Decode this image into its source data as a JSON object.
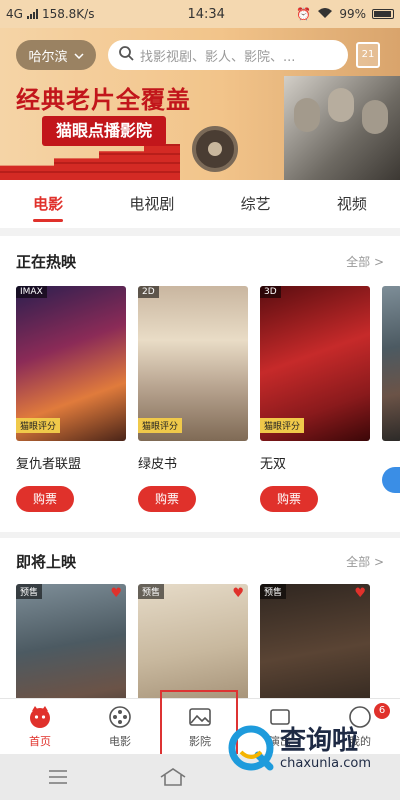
{
  "status_bar": {
    "network": "4G",
    "speed": "158.8K/s",
    "time": "14:34",
    "battery": "99%"
  },
  "header": {
    "city": "哈尔滨",
    "search_placeholder": "找影视剧、影人、影院、...",
    "calendar_day": "21"
  },
  "banner": {
    "headline": "经典老片全覆盖",
    "subline": "猫眼点播影院"
  },
  "tabs": [
    {
      "label": "电影"
    },
    {
      "label": "电视剧"
    },
    {
      "label": "综艺"
    },
    {
      "label": "视频"
    }
  ],
  "hot_section": {
    "title": "正在热映",
    "more": "全部 >",
    "cards": [
      {
        "name": "复仇者联盟",
        "button": "购票",
        "badge": "IMAX",
        "tag": "猫眼评分"
      },
      {
        "name": "绿皮书",
        "button": "购票",
        "badge": "2D",
        "tag": "猫眼评分"
      },
      {
        "name": "无双",
        "button": "购票",
        "badge": "3D",
        "tag": "猫眼评分"
      }
    ]
  },
  "coming_section": {
    "title": "即将上映",
    "more": "全部 >",
    "cards": [
      {
        "badge": "预售"
      },
      {
        "badge": "预售"
      },
      {
        "badge": "预售"
      }
    ]
  },
  "bottom_nav": [
    {
      "label": "首页"
    },
    {
      "label": "电影"
    },
    {
      "label": "影院"
    },
    {
      "label": "演出"
    },
    {
      "label": "我的",
      "badge": "6"
    }
  ],
  "watermark": {
    "cn": "查询啦",
    "en": "chaxunla.com"
  },
  "colors": {
    "accent": "#e0312b",
    "banner_bg": "#f2c48a",
    "highlight": "#d33333"
  }
}
